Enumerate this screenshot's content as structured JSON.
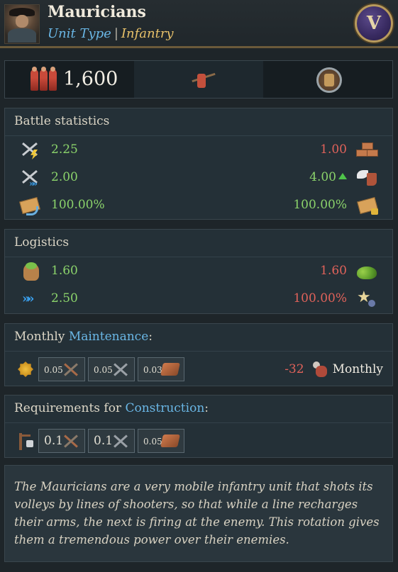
{
  "header": {
    "unit_name": "Mauricians",
    "unit_type_label": "Unit Type",
    "separator": "|",
    "category": "Infantry",
    "badge": "V",
    "portrait_icon": "musketeer-portrait"
  },
  "topbar": {
    "men_count": "1,600",
    "men_icon": "soldiers-icon",
    "unit_class_icon": "musketeer-icon",
    "commander_icon": "commander-icon"
  },
  "battle": {
    "title": "Battle statistics",
    "rows": [
      {
        "left_icon": "melee-attack-icon",
        "left_value": "2.25",
        "right_value": "1.00",
        "right_icon": "bricks-icon"
      },
      {
        "left_icon": "charge-icon",
        "left_value": "2.00",
        "right_value": "4.00",
        "right_icon": "speed-boot-icon"
      },
      {
        "left_icon": "morale-envelope-icon",
        "left_value": "100.00%",
        "right_value": "100.00%",
        "right_icon": "locked-envelope-icon"
      }
    ]
  },
  "logistics": {
    "title": "Logistics",
    "rows": [
      {
        "left_icon": "supply-sack-icon",
        "left_value": "1.60",
        "right_value": "1.60",
        "right_icon": "vegetables-icon"
      },
      {
        "left_icon": "movement-chevrons-icon",
        "left_value": "2.50",
        "right_value": "100.00%",
        "right_icon": "experience-star-icon"
      }
    ]
  },
  "maintenance": {
    "title_prefix": "Monthly ",
    "title_highlight": "Maintenance",
    "title_suffix": ":",
    "resources": [
      {
        "value": "0.05",
        "icon": "weapons-icon"
      },
      {
        "value": "0.05",
        "icon": "tools-icon"
      },
      {
        "value": "0.03",
        "icon": "wood-icon"
      }
    ],
    "population_change": "-32",
    "period": "Monthly"
  },
  "requirements": {
    "title_prefix": "Requirements for ",
    "title_highlight": "Construction",
    "title_suffix": ":",
    "resources": [
      {
        "value": "0.1",
        "icon": "weapons-icon"
      },
      {
        "value": "0.1",
        "icon": "tools-icon"
      },
      {
        "value": "0.05",
        "icon": "wood-icon"
      }
    ]
  },
  "description": "The Mauricians are a very mobile infantry unit that shots its volleys by lines of shooters, so that while a line recharges their arms, the next is firing at the enemy. This rotation gives them a tremendous power over their enemies."
}
